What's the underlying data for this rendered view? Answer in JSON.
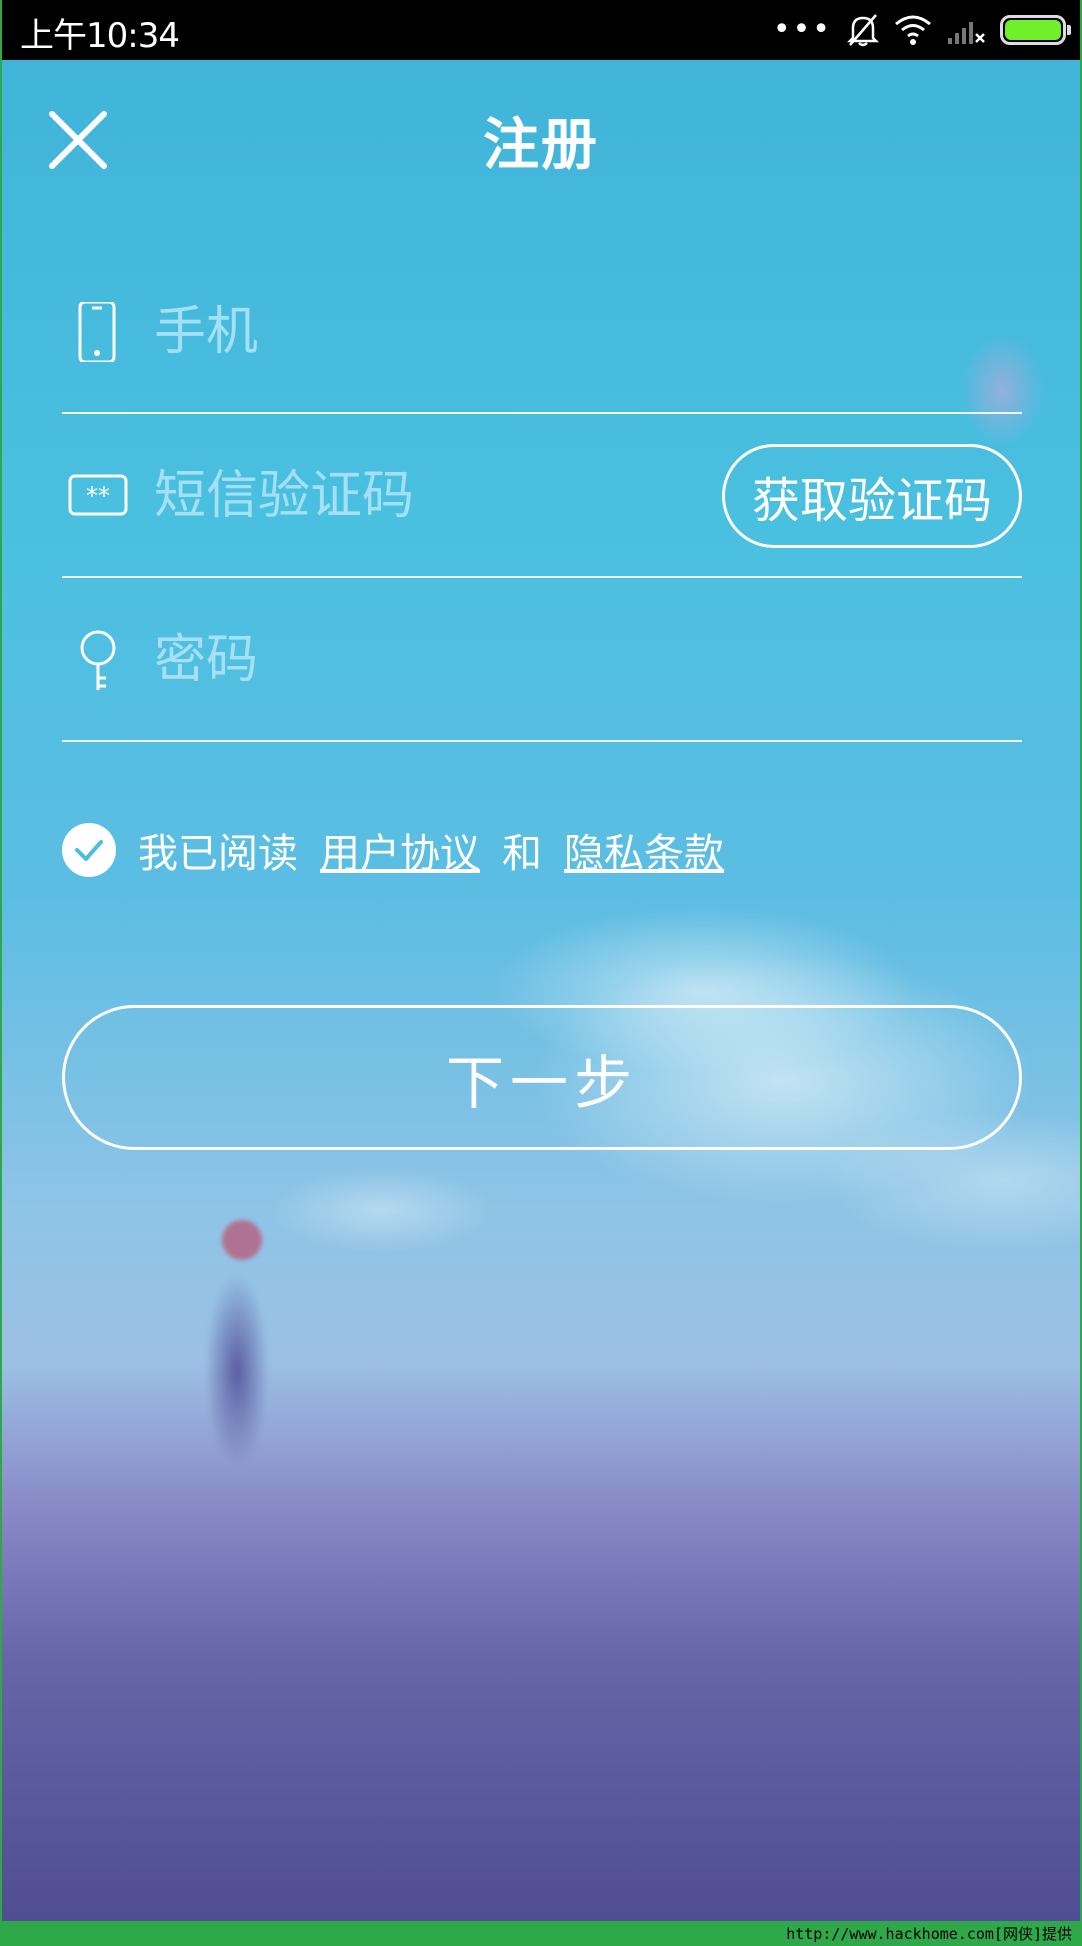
{
  "status_bar": {
    "time": "上午10:34",
    "icons": [
      "more-dots-icon",
      "bell-muted-icon",
      "wifi-icon",
      "signal-off-icon",
      "battery-icon"
    ],
    "more_dots": "•••"
  },
  "header": {
    "title": "注册",
    "close_icon": "close-icon"
  },
  "form": {
    "phone": {
      "placeholder": "手机",
      "icon": "phone-icon"
    },
    "sms_code": {
      "placeholder": "短信验证码",
      "icon": "sms-code-icon",
      "button_label": "获取验证码"
    },
    "password": {
      "placeholder": "密码",
      "icon": "key-icon"
    }
  },
  "agreement": {
    "checked": true,
    "prefix": "我已阅读",
    "user_agreement": "用户协议",
    "connector": "和",
    "privacy": "隐私条款"
  },
  "next_button": "下一步",
  "watermark": "http://www.hackhome.com[网侠]提供",
  "colors": {
    "accent": "#4ac0e0",
    "frame": "#2fa84a",
    "battery": "#6ff02a"
  }
}
